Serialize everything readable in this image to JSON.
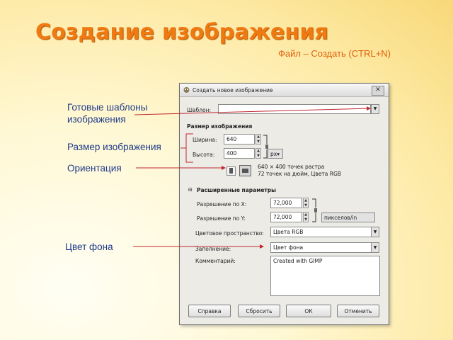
{
  "slide": {
    "title": "Создание изображения",
    "subtitle": "Файл – Создать (CTRL+N)"
  },
  "labels": {
    "templates": "Готовые  шаблоны изображения",
    "templates_line1": "Готовые  шаблоны",
    "templates_line2": "изображения",
    "size": "Размер изображения",
    "orientation": "Ориентация",
    "bg": "Цвет фона"
  },
  "dialog": {
    "title": "Создать новое изображение",
    "template_label": "Шаблон:",
    "template_value": "",
    "size_heading": "Размер изображения",
    "width_label": "Ширина:",
    "width_value": "640",
    "height_label": "Высота:",
    "height_value": "400",
    "unit_value": "px",
    "info_line1": "640 × 400 точек растра",
    "info_line2": "72 точек на дюйм, Цвета RGB",
    "advanced_heading": "Расширенные параметры",
    "xres_label": "Разрешение по X:",
    "xres_value": "72,000",
    "yres_label": "Разрешение по Y:",
    "yres_value": "72,000",
    "res_unit_value": "пикселов/in",
    "colorspace_label": "Цветовое пространство:",
    "colorspace_value": "Цвета RGB",
    "fill_label": "Заполнение:",
    "fill_value": "Цвет фона",
    "comment_label": "Комментарий:",
    "comment_value": "Created with GIMP",
    "buttons": {
      "help": "Справка",
      "reset": "Сбросить",
      "ok": "ОК",
      "cancel": "Отменить"
    }
  },
  "colors": {
    "title": "#f07a12",
    "label": "#1f3c8a",
    "arrow": "#c0282e"
  }
}
